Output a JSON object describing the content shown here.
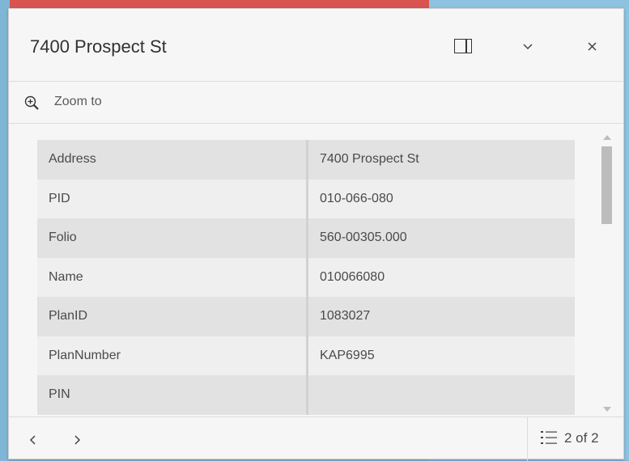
{
  "popup": {
    "title": "7400 Prospect St",
    "actions": {
      "zoom_label": "Zoom to"
    },
    "attributes": [
      {
        "key": "Address",
        "value": "7400 Prospect St"
      },
      {
        "key": "PID",
        "value": "010-066-080"
      },
      {
        "key": "Folio",
        "value": "560-00305.000"
      },
      {
        "key": "Name",
        "value": "010066080"
      },
      {
        "key": "PlanID",
        "value": "1083027"
      },
      {
        "key": "PlanNumber",
        "value": "KAP6995"
      },
      {
        "key": "PIN",
        "value": ""
      }
    ],
    "footer": {
      "count": "2 of 2"
    },
    "icons": {
      "dock": "dock-icon",
      "collapse": "chevron-down-icon",
      "close": "close-icon",
      "zoom": "zoom-in-icon",
      "prev": "chevron-left-icon",
      "next": "chevron-right-icon",
      "list": "list-icon"
    }
  }
}
